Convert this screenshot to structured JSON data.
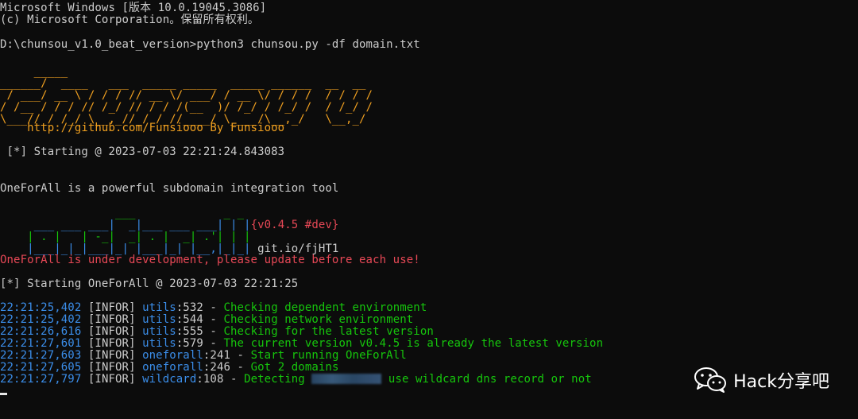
{
  "terminal": {
    "header_line1": "Microsoft Windows [版本 10.0.19045.3086]",
    "header_line2": "(c) Microsoft Corporation。保留所有权利。",
    "prompt_line": "D:\\chunsou_v1.0_beat_version>python3 chunsou.py -df domain.txt",
    "chunsou_banner": [
      "     _____",
      "______/  ____   ___  _____ _____  _____ ______  __  __",
      " / ___/ __ \\ / / / // __ \\/ ___/ / __ \\/ / / /  / / / /",
      "/ /__ / / / // /_/ // / / /(__  )/ /_/ / /_/ /  / /_/ / ",
      "\\___//_/ /_/ \\__,_//_/ /_//____/ \\____/\\__,_/   \\__,_/  "
    ],
    "github_line": "    http://github.com/Funsiooo By Funsiooo",
    "start_line": " [*] Starting @ 2023-07-03 22:21:24.843083",
    "oneforall_desc": "OneForAll is a powerful subdomain integration tool",
    "oneforall_banner": [
      "             ___             _ _",
      " ___ ___ ___|  _|___ ___ ___| | |",
      "| . |   | -_|  _| . |  _| .'| | |",
      "|___|_|_|___|_| |___|_| |__,|_|_|"
    ],
    "version_label": "{v0.4.5 #dev}",
    "git_link": "git.io/fjHT1",
    "dev_warning": "OneForAll is under development, please update before each use!",
    "oneforall_start": "[*] Starting OneForAll @ 2023-07-03 22:21:25",
    "logs": [
      {
        "time": "22:21:25,402",
        "level": "[INFOR]",
        "module": "utils",
        "lineno": ":532",
        "sep": " - ",
        "message": "Checking dependent environment"
      },
      {
        "time": "22:21:25,402",
        "level": "[INFOR]",
        "module": "utils",
        "lineno": ":544",
        "sep": " - ",
        "message": "Checking network environment"
      },
      {
        "time": "22:21:26,616",
        "level": "[INFOR]",
        "module": "utils",
        "lineno": ":555",
        "sep": " - ",
        "message": "Checking for the latest version"
      },
      {
        "time": "22:21:27,601",
        "level": "[INFOR]",
        "module": "utils",
        "lineno": ":579",
        "sep": " - ",
        "message": "The current version v0.4.5 is already the latest version"
      },
      {
        "time": "22:21:27,603",
        "level": "[INFOR]",
        "module": "oneforall",
        "lineno": ":241",
        "sep": " - ",
        "message": "Start running OneForAll"
      },
      {
        "time": "22:21:27,605",
        "level": "[INFOR]",
        "module": "oneforall",
        "lineno": ":246",
        "sep": " - ",
        "message": "Got 2 domains"
      },
      {
        "time": "22:21:27,797",
        "level": "[INFOR]",
        "module": "wildcard",
        "lineno": ":108",
        "sep": " - ",
        "message_prefix": "Detecting ",
        "message_suffix": " use wildcard dns record or not"
      }
    ]
  },
  "watermark": {
    "text": "Hack分享吧",
    "icon": "wechat-icon"
  },
  "colors": {
    "background": "#0c0c0c",
    "text": "#cccccc",
    "banner_orange": "#f0a020",
    "red": "#e74856",
    "blue": "#3b8eea",
    "green": "#16c60c",
    "oneforall_banner": [
      "#16c60c",
      "#3b8eea",
      "#e5b54b",
      "#e74856",
      "#b4009e",
      "#61d6d6",
      "#f9f1a5"
    ]
  }
}
